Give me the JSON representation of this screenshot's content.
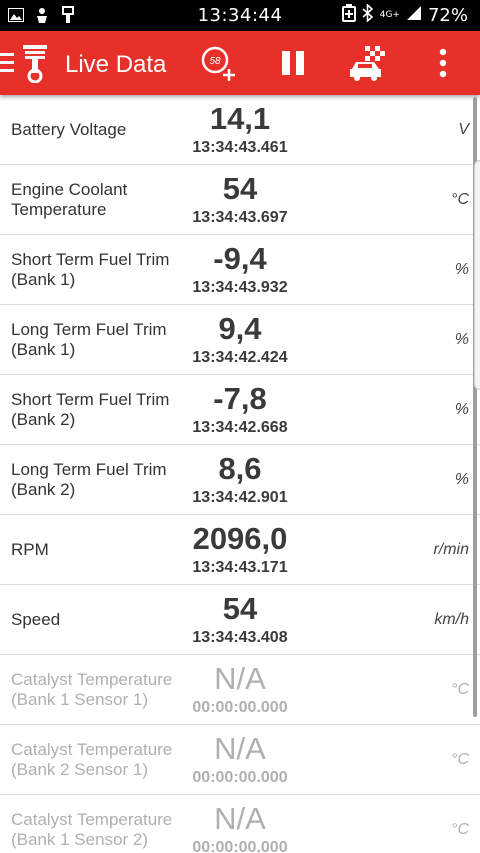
{
  "status_bar": {
    "clock": "13:34:44",
    "network": "4G+",
    "battery": "72%"
  },
  "toolbar": {
    "title": "Live Data",
    "add_gauge_badge": "58"
  },
  "rows": [
    {
      "label": "Battery Voltage",
      "value": "14,1",
      "time": "13:34:43.461",
      "unit": "V"
    },
    {
      "label": "Engine Coolant Temperature",
      "value": "54",
      "time": "13:34:43.697",
      "unit": "°C"
    },
    {
      "label": "Short Term Fuel Trim (Bank 1)",
      "value": "-9,4",
      "time": "13:34:43.932",
      "unit": "%"
    },
    {
      "label": "Long Term Fuel Trim (Bank 1)",
      "value": "9,4",
      "time": "13:34:42.424",
      "unit": "%"
    },
    {
      "label": "Short Term Fuel Trim (Bank 2)",
      "value": "-7,8",
      "time": "13:34:42.668",
      "unit": "%"
    },
    {
      "label": "Long Term Fuel Trim (Bank 2)",
      "value": "8,6",
      "time": "13:34:42.901",
      "unit": "%"
    },
    {
      "label": "RPM",
      "value": "2096,0",
      "time": "13:34:43.171",
      "unit": "r/min"
    },
    {
      "label": "Speed",
      "value": "54",
      "time": "13:34:43.408",
      "unit": "km/h"
    },
    {
      "label": "Catalyst Temperature (Bank 1 Sensor 1)",
      "value": "N/A",
      "time": "00:00:00.000",
      "unit": "°C"
    },
    {
      "label": "Catalyst Temperature (Bank 2 Sensor 1)",
      "value": "N/A",
      "time": "00:00:00.000",
      "unit": "°C"
    },
    {
      "label": "Catalyst Temperature (Bank 1 Sensor 2)",
      "value": "N/A",
      "time": "00:00:00.000",
      "unit": "°C"
    }
  ],
  "colors": {
    "toolbar": "#e8302a",
    "status_bar": "#000000",
    "inactive_text": "#b0b0b0"
  }
}
